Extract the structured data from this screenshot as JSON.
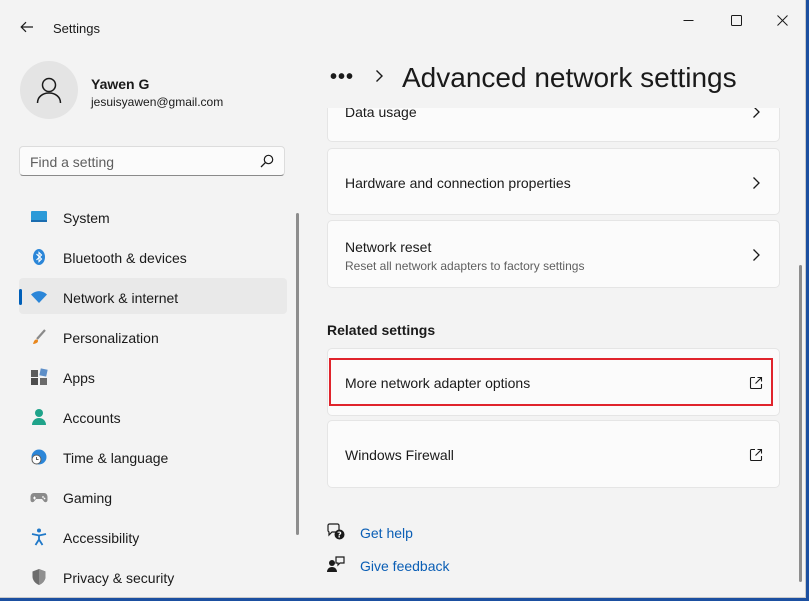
{
  "window": {
    "title": "Settings"
  },
  "profile": {
    "name": "Yawen G",
    "email": "jesuisyawen@gmail.com"
  },
  "search": {
    "placeholder": "Find a setting"
  },
  "nav": {
    "items": [
      {
        "label": "System",
        "icon": "monitor-icon"
      },
      {
        "label": "Bluetooth & devices",
        "icon": "bluetooth-icon"
      },
      {
        "label": "Network & internet",
        "icon": "wifi-icon",
        "selected": true
      },
      {
        "label": "Personalization",
        "icon": "brush-icon"
      },
      {
        "label": "Apps",
        "icon": "apps-icon"
      },
      {
        "label": "Accounts",
        "icon": "person-icon"
      },
      {
        "label": "Time & language",
        "icon": "globe-clock-icon"
      },
      {
        "label": "Gaming",
        "icon": "gamepad-icon"
      },
      {
        "label": "Accessibility",
        "icon": "accessibility-icon"
      },
      {
        "label": "Privacy & security",
        "icon": "shield-icon"
      }
    ]
  },
  "header": {
    "breadcrumb_more": "•••",
    "title": "Advanced network settings"
  },
  "cards": {
    "data_usage": {
      "title": "Data usage"
    },
    "hardware": {
      "title": "Hardware and connection properties"
    },
    "network_reset": {
      "title": "Network reset",
      "subtitle": "Reset all network adapters to factory settings"
    }
  },
  "related": {
    "heading": "Related settings",
    "more_adapter": {
      "title": "More network adapter options"
    },
    "firewall": {
      "title": "Windows Firewall"
    }
  },
  "help": {
    "get_help": "Get help",
    "give_feedback": "Give feedback"
  },
  "colors": {
    "accent": "#005fb8",
    "link": "#0a5eb5",
    "highlight": "#e0242c"
  }
}
